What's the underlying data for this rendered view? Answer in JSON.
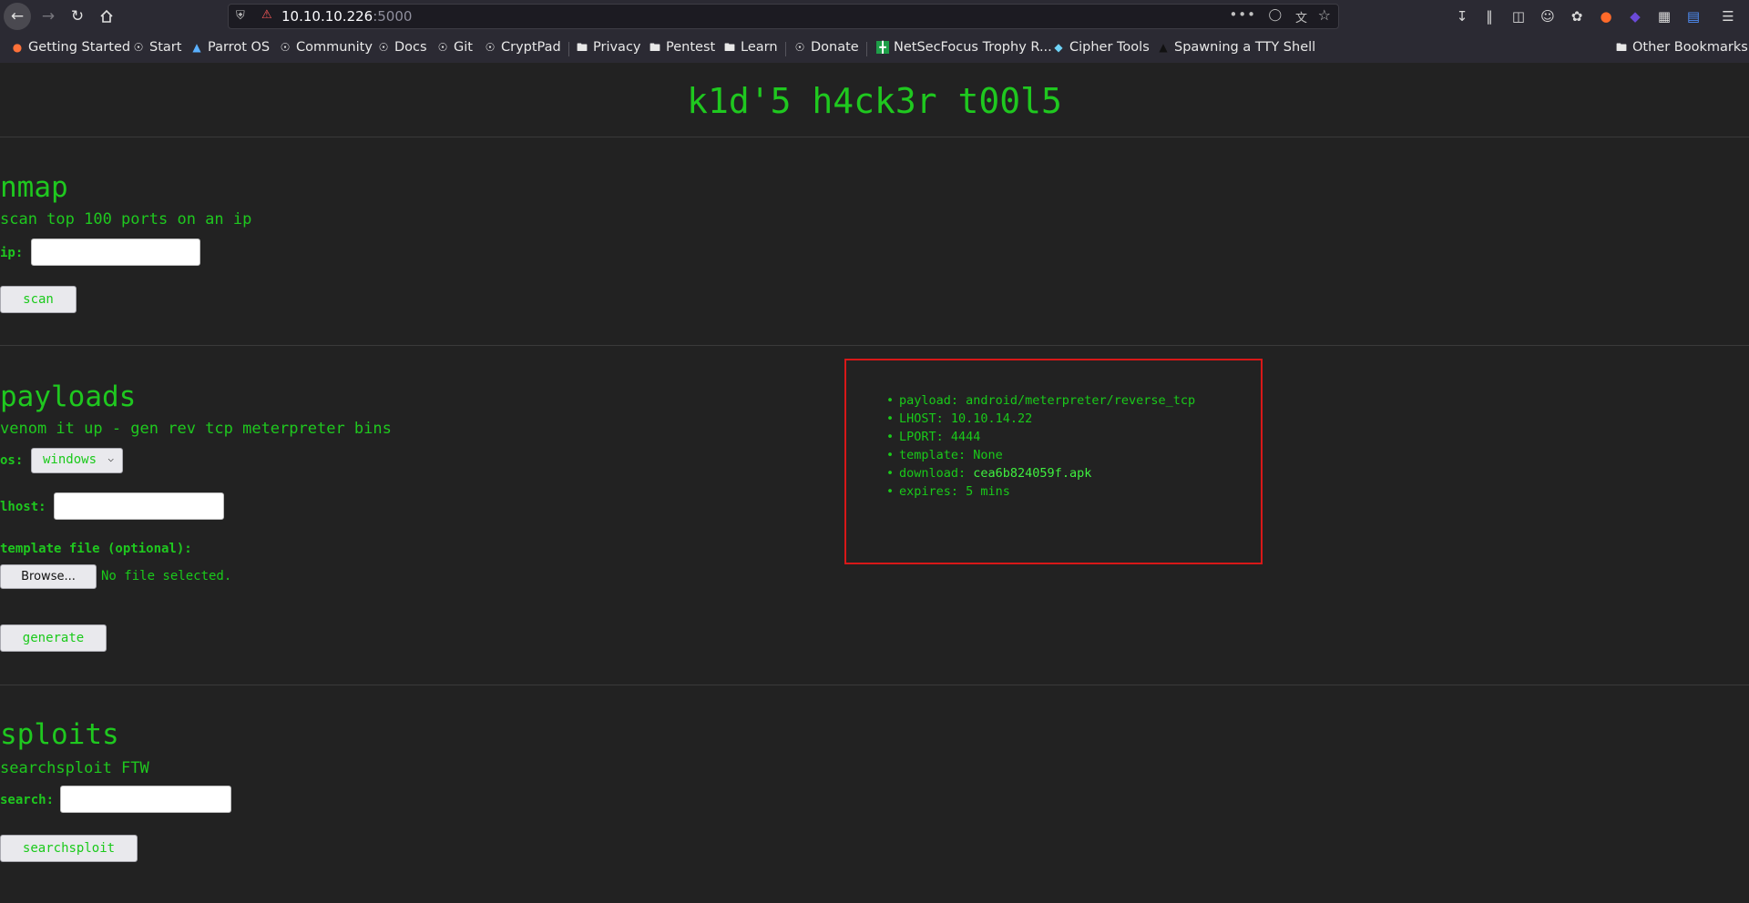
{
  "browser": {
    "url_host": "10.10.10.226",
    "url_port": ":5000",
    "bookmarks": [
      {
        "label": "Getting Started",
        "icon": "firefox-icon"
      },
      {
        "label": "Start",
        "icon": "globe-icon"
      },
      {
        "label": "Parrot OS",
        "icon": "parrot-icon"
      },
      {
        "label": "Community",
        "icon": "globe-icon"
      },
      {
        "label": "Docs",
        "icon": "globe-icon"
      },
      {
        "label": "Git",
        "icon": "globe-icon"
      },
      {
        "label": "CryptPad",
        "icon": "globe-icon"
      },
      {
        "label": "Privacy",
        "icon": "folder-icon"
      },
      {
        "label": "Pentest",
        "icon": "folder-icon"
      },
      {
        "label": "Learn",
        "icon": "folder-icon"
      },
      {
        "label": "Donate",
        "icon": "globe-icon"
      },
      {
        "label": "NetSecFocus Trophy R...",
        "icon": "sheet-icon"
      },
      {
        "label": "Cipher Tools",
        "icon": "cipher-icon"
      },
      {
        "label": "Spawning a TTY Shell",
        "icon": "shell-icon"
      }
    ],
    "other_bookmarks": "Other Bookmarks"
  },
  "page": {
    "title": "k1d'5 h4ck3r t00l5",
    "nmap": {
      "title": "nmap",
      "description": "scan top 100 ports on an ip",
      "ip_label": "ip:",
      "ip_value": "",
      "scan_label": "scan"
    },
    "payloads": {
      "title": "payloads",
      "description": "venom it up - gen rev tcp meterpreter bins",
      "os_label": "os:",
      "os_value": "windows",
      "lhost_label": "lhost:",
      "lhost_value": "",
      "template_label": "template file (optional):",
      "browse_label": "Browse...",
      "no_file_text": "No file selected.",
      "generate_label": "generate",
      "result": {
        "payload": "payload: android/meterpreter/reverse_tcp",
        "lhost": "LHOST: 10.10.14.22",
        "lport": "LPORT: 4444",
        "template": "template: None",
        "download_prefix": "download: ",
        "download_link": "cea6b824059f.apk",
        "expires": "expires: 5 mins"
      }
    },
    "sploits": {
      "title": "sploits",
      "description": "searchsploit FTW",
      "search_label": "search:",
      "search_value": "",
      "searchsploit_label": "searchsploit"
    }
  },
  "colors": {
    "background": "#222222",
    "text_green": "#1fc81f",
    "result_border": "#d81818"
  }
}
